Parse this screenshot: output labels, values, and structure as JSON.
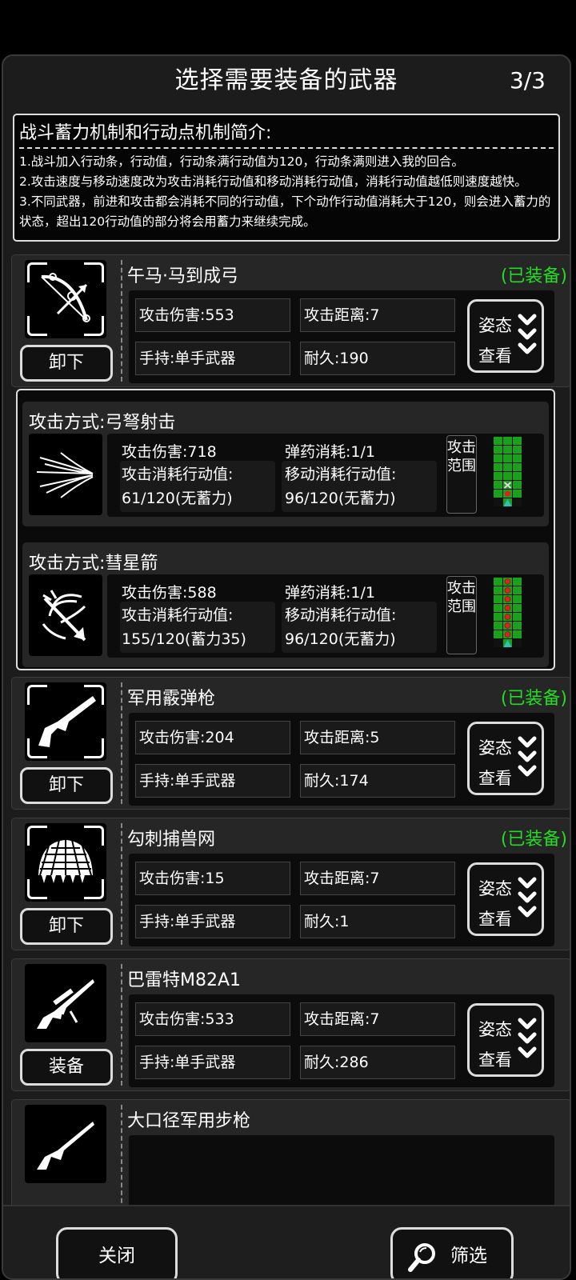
{
  "header": {
    "title": "选择需要装备的武器",
    "page_indicator": "3/3"
  },
  "intro": {
    "heading": "战斗蓄力机制和行动点机制简介:",
    "lines": [
      "1.战斗加入行动条，行动值，行动条满行动值为120，行动条满则进入我的回合。",
      "2.攻击速度与移动速度改为攻击消耗行动值和移动消耗行动值，消耗行动值越低则速度越快。",
      "3.不同武器，前进和攻击都会消耗不同的行动值，下个动作行动值消耗大于120，则会进入蓄力的状态，超出120行动值的部分将会用蓄力来继续完成。"
    ]
  },
  "stance_labels": {
    "line1": "姿态",
    "line2": "查看"
  },
  "weapons": [
    {
      "name": "午马·马到成弓",
      "status": "(已装备)",
      "action": "卸下",
      "damage": "攻击伤害:553",
      "range": "攻击距离:7",
      "hold": "手持:单手武器",
      "durability": "耐久:190",
      "icon": "bow-icon"
    },
    {
      "name": "军用霰弹枪",
      "status": "(已装备)",
      "action": "卸下",
      "damage": "攻击伤害:204",
      "range": "攻击距离:5",
      "hold": "手持:单手武器",
      "durability": "耐久:174",
      "icon": "shotgun-icon"
    },
    {
      "name": "勾刺捕兽网",
      "status": "(已装备)",
      "action": "卸下",
      "damage": "攻击伤害:15",
      "range": "攻击距离:7",
      "hold": "手持:单手武器",
      "durability": "耐久:1",
      "icon": "net-icon"
    },
    {
      "name": "巴雷特M82A1",
      "status": "",
      "action": "装备",
      "damage": "攻击伤害:533",
      "range": "攻击距离:7",
      "hold": "手持:单手武器",
      "durability": "耐久:286",
      "icon": "sniper-rifle-icon"
    },
    {
      "name": "大口径军用步枪",
      "icon": "rifle-icon"
    }
  ],
  "attack_modes": [
    {
      "title": "攻击方式:弓弩射击",
      "damage": "攻击伤害:718",
      "ammo": "弹药消耗:1/1",
      "atk_cost_label": "攻击消耗行动值:",
      "atk_cost_value": "61/120(无蓄力)",
      "move_cost_label": "移动消耗行动值:",
      "move_cost_value": "96/120(无蓄力)",
      "range_label": "攻击范围",
      "icon": "arrow-volley-icon",
      "range_pattern": "target-x"
    },
    {
      "title": "攻击方式:彗星箭",
      "damage": "攻击伤害:588",
      "ammo": "弹药消耗:1/1",
      "atk_cost_label": "攻击消耗行动值:",
      "atk_cost_value": "155/120(蓄力35)",
      "move_cost_label": "移动消耗行动值:",
      "move_cost_value": "96/120(无蓄力)",
      "range_label": "攻击范围",
      "icon": "comet-arrow-icon",
      "range_pattern": "red-dots"
    }
  ],
  "footer": {
    "close_label": "关闭",
    "filter_label": "筛选"
  },
  "colors": {
    "equipped": "#22dd22",
    "range_grid": "#1aa01a",
    "range_dot": "#e02020",
    "player_marker": "#30c0c0"
  }
}
